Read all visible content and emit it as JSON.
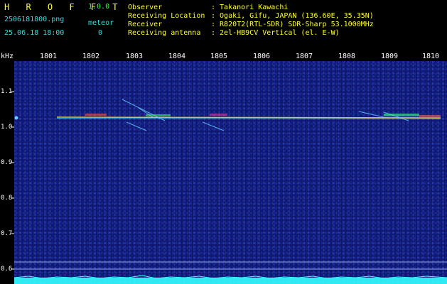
{
  "app": {
    "logo": "H R O F F T",
    "version": "1.0.0",
    "filename": "2506181800.png",
    "datetime": "25.06.18 18:00",
    "meteor_label": "meteor",
    "meteor_count": "0"
  },
  "info": {
    "labels": [
      "Observer",
      "Receiving Location",
      "Receiver",
      "Receiving antenna"
    ],
    "values": [
      ": Takanori Kawachi",
      ": Ogaki, Gifu, JAPAN (136.60E, 35.35N)",
      ": R820T2(RTL-SDR) SDR-Sharp 53.1000MHz",
      ": 2el-HB9CV Vertical (el. E-W)"
    ]
  },
  "spectrogram": {
    "y_unit": "kHz",
    "time_ticks": [
      "1801",
      "1802",
      "1803",
      "1804",
      "1805",
      "1806",
      "1807",
      "1808",
      "1809",
      "1810"
    ],
    "freq_ticks": [
      "1.1",
      "1.0",
      "0.9",
      "0.8",
      "0.7",
      "0.6"
    ],
    "colors": {
      "background": "#101a72",
      "carrier": "#ffdd33",
      "trail": "#66ccff",
      "baseline": "#33ffff"
    }
  }
}
